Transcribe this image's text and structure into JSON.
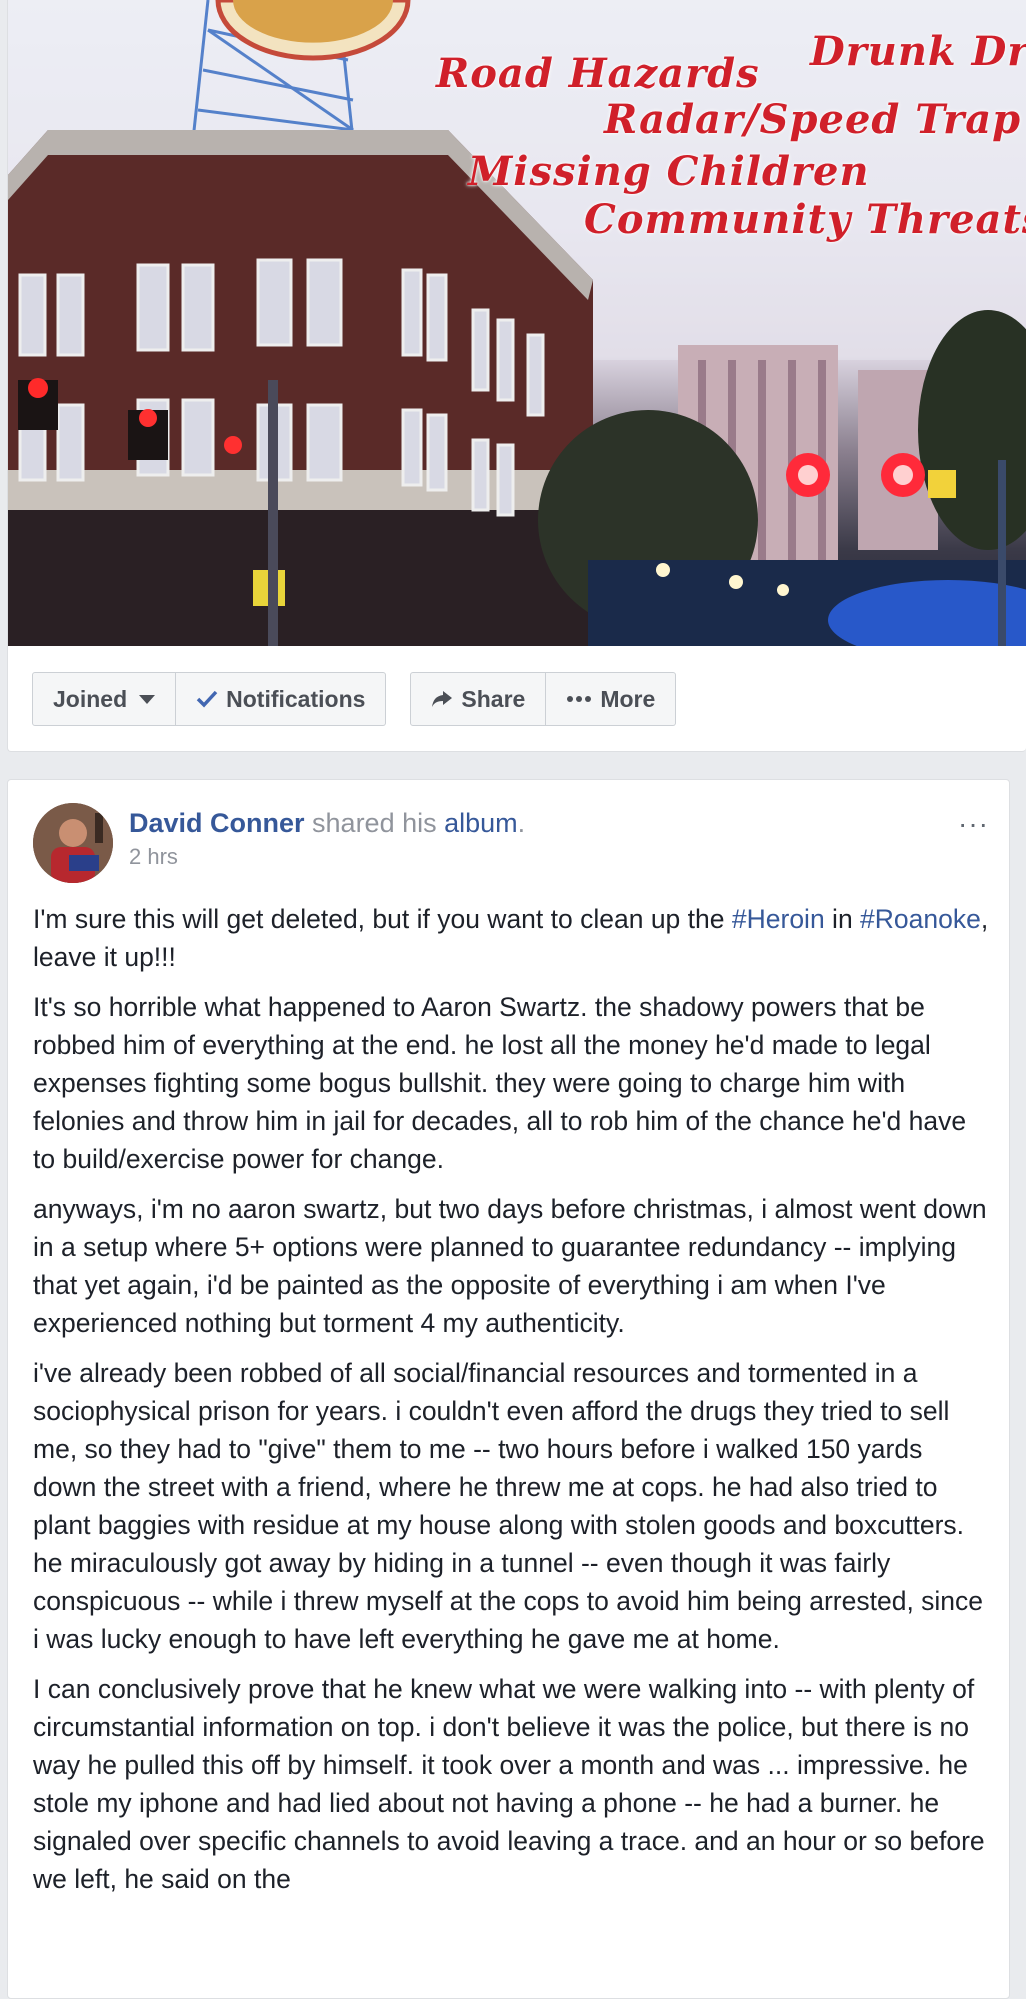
{
  "cover": {
    "overlay_lines": [
      "Drunk Dri",
      "Road Hazards",
      "Radar/Speed Trap",
      "Missing Children",
      "Community Threats"
    ]
  },
  "actions": {
    "joined": "Joined",
    "notifications": "Notifications",
    "share": "Share",
    "more": "More"
  },
  "post": {
    "author": "David Conner",
    "shared_text": " shared his ",
    "album": "album",
    "period": ".",
    "timestamp": "2 hrs",
    "menu": "···",
    "intro": {
      "before": "I'm sure this will get deleted, but if you want to clean up the ",
      "tag1": "#Heroin",
      "middle": " in ",
      "tag2": "#Roanoke",
      "after": ", leave it up!!!"
    },
    "paragraphs": [
      "It's so horrible what happened to Aaron Swartz. the shadowy powers that be robbed him of everything at the end. he lost all the money he'd made to legal expenses fighting some bogus bullshit. they were going to charge him with felonies and throw him in jail for decades, all to rob him of the chance he'd have to build/exercise power for change.",
      "anyways, i'm no aaron swartz, but two days before christmas, i almost went down in a setup where 5+ options were planned to guarantee redundancy -- implying that yet again, i'd be painted as the opposite of everything i am when I've experienced nothing but torment 4 my authenticity.",
      "i've already been robbed of all social/financial resources and tormented in a sociophysical prison for years. i couldn't even afford the drugs they tried to sell me, so they had to \"give\" them to me -- two hours before i walked 150 yards down the street with a friend, where he threw me at cops. he had also tried to plant baggies with residue at my house along with stolen goods and boxcutters. he miraculously got away by hiding in a tunnel -- even though it was fairly conspicuous -- while i threw myself at the cops to avoid him being arrested, since i was lucky enough to have left everything he gave me at home.",
      "I can conclusively prove that he knew what we were walking into -- with plenty of circumstantial information on top. i don't believe it was the police, but there is no way he pulled this off by himself. it took over a month and was ... impressive. he stole my iphone and had lied about not having a phone -- he had a burner. he signaled over specific channels to avoid leaving a trace. and an hour or so before we left, he said on the"
    ]
  },
  "colors": {
    "link": "#365899",
    "text": "#1d2129",
    "muted": "#90949c",
    "cover_text": "#d0202a",
    "page_bg": "#e9ebee"
  }
}
